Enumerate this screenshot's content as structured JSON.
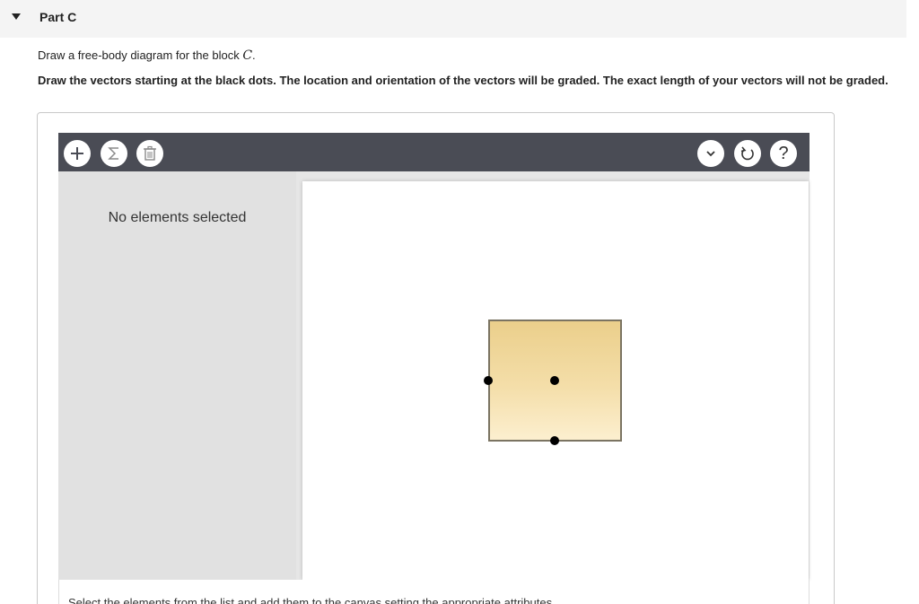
{
  "part": {
    "title": "Part C"
  },
  "prompt": {
    "line1_prefix": "Draw a free-body diagram for the block ",
    "line1_var": "C",
    "line1_suffix": ".",
    "line2": "Draw the vectors starting at the black dots. The location and orientation of the vectors will be graded. The exact length of your vectors will not be graded."
  },
  "toolbar": {
    "left_icons": [
      "plus-icon",
      "sigma-icon",
      "trash-icon"
    ],
    "right_icons": [
      "chevron-down-icon",
      "reset-icon",
      "help-icon"
    ],
    "help_label": "?"
  },
  "side_panel": {
    "empty_text": "No elements selected"
  },
  "instructions": "Select the elements from the list and add them to the canvas setting the appropriate attributes.",
  "colors": {
    "toolbar_bg": "#4a4c55",
    "side_bg": "#e1e1e1",
    "block_top": "#ebcf8b",
    "block_bottom": "#fcefcf",
    "block_border": "#7b7462"
  }
}
